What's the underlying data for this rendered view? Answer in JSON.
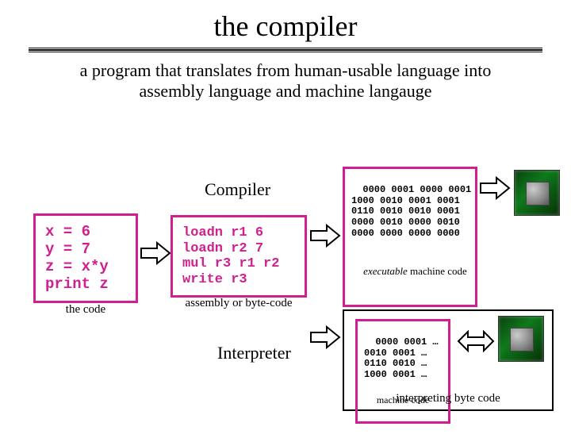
{
  "title": "the compiler",
  "subtitle": "a program that translates from human-usable language into assembly language and machine langauge",
  "labels": {
    "compiler": "Compiler",
    "interpreter": "Interpreter"
  },
  "source": {
    "code": "x = 6\ny = 7\nz = x*y\nprint z",
    "caption": "the code"
  },
  "assembly": {
    "code": "loadn r1 6\nloadn r2 7\nmul r3 r1 r2\nwrite r3",
    "caption": "assembly or byte-code"
  },
  "machine": {
    "code": "0000 0001 0000 0001\n1000 0010 0001 0001\n0110 0010 0010 0001\n0000 0010 0000 0010\n0000 0000 0000 0000",
    "caption_html": "executable",
    "caption_tail": " machine code"
  },
  "interpreter_out": {
    "code": "0000 0001 …\n0010 0001 …\n0110 0010 …\n1000 0001 …",
    "caption": "machine code",
    "footer": "interpreting byte code"
  },
  "icons": {
    "cpu": "cpu-chip"
  }
}
